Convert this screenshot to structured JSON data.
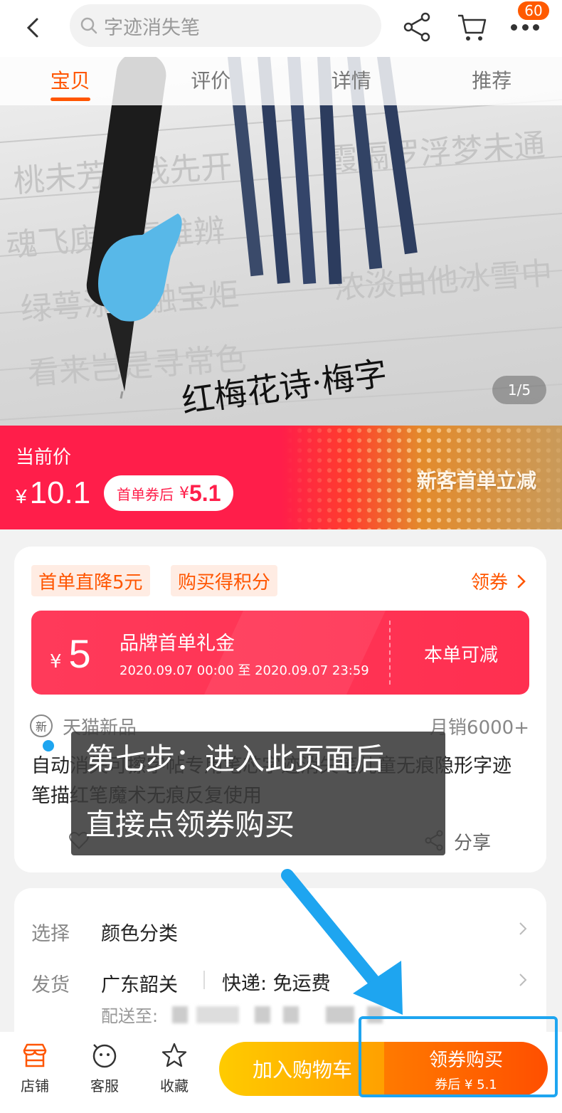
{
  "search": {
    "placeholder": "字迹消失笔"
  },
  "header": {
    "more_badge": "60"
  },
  "hero": {
    "tabs": [
      "宝贝",
      "评价",
      "详情",
      "推荐"
    ],
    "counter": "1/5",
    "calligraphy": "红梅花诗·梅字"
  },
  "price": {
    "label": "当前价",
    "currency": "¥",
    "value": "10.1",
    "coupon_text": "首单券后",
    "coupon_currency": "¥",
    "coupon_value": "5.1",
    "promo": "新客首单立减"
  },
  "tags": [
    "首单直降5元",
    "购买得积分"
  ],
  "get_coupon": "领券",
  "gift": {
    "currency": "¥",
    "amount": "5",
    "title": "品牌首单礼金",
    "time": "2020.09.07 00:00 至 2020.09.07 23:59",
    "right": "本单可减"
  },
  "product": {
    "new_badge": "新",
    "tmall_new": "天猫新品",
    "monthly_sales": "月销6000+",
    "title": "自动消失可擦字帖专用笔芯字迹消失笔儿童无痕隐形字迹笔描红笔魔术无痕反复使用",
    "share": "分享"
  },
  "options": {
    "select_label": "选择",
    "select_value": "颜色分类",
    "ship_label": "发货",
    "ship_from": "广东韶关",
    "ship_method": "快递: 免运费",
    "deliver_to": "配送至:"
  },
  "tooltip": {
    "line1": "第七步：进入此页面后",
    "line2": "直接点领券购买"
  },
  "bottom": {
    "store": "店铺",
    "service": "客服",
    "favorite": "收藏",
    "add_cart": "加入购物车",
    "buy": "领券购买",
    "buy_sub": "券后 ¥ 5.1"
  },
  "colors": {
    "accent": "#ff5500",
    "red": "#ff1e4a",
    "highlight": "#1ea5f0"
  }
}
